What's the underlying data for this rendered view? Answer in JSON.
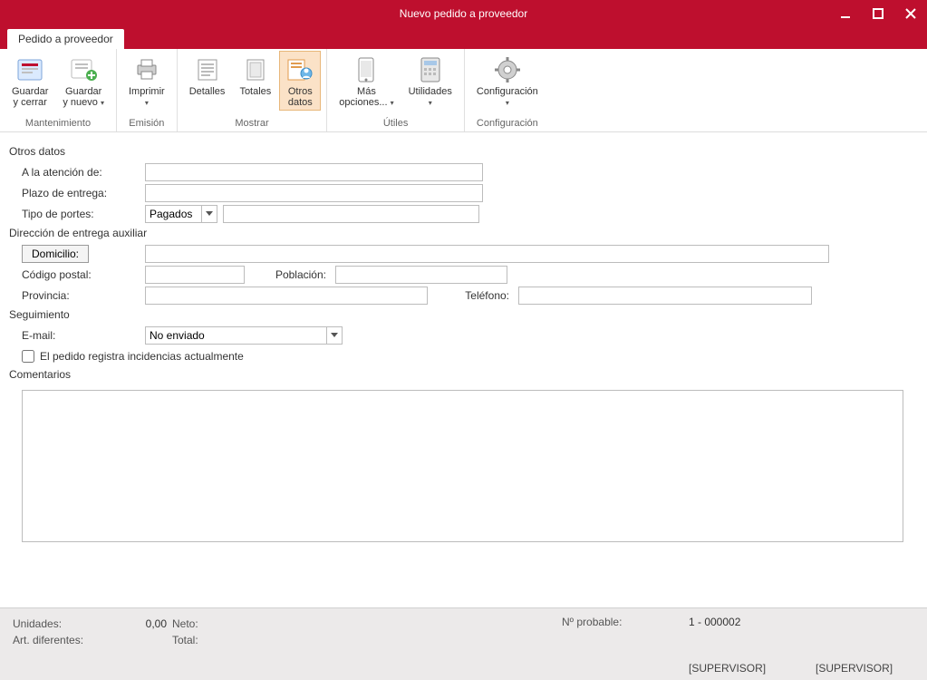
{
  "window": {
    "title": "Nuevo pedido a proveedor"
  },
  "tab": {
    "label": "Pedido a proveedor"
  },
  "ribbon": {
    "groups": [
      {
        "label": "Mantenimiento",
        "buttons": [
          {
            "line1": "Guardar",
            "line2": "y cerrar"
          },
          {
            "line1": "Guardar",
            "line2": "y nuevo",
            "dropdown": true
          }
        ]
      },
      {
        "label": "Emisión",
        "buttons": [
          {
            "line1": "Imprimir",
            "line2": "",
            "dropdown": true
          }
        ]
      },
      {
        "label": "Mostrar",
        "buttons": [
          {
            "line1": "Detalles",
            "line2": ""
          },
          {
            "line1": "Totales",
            "line2": ""
          },
          {
            "line1": "Otros",
            "line2": "datos",
            "active": true
          }
        ]
      },
      {
        "label": "Útiles",
        "buttons": [
          {
            "line1": "Más",
            "line2": "opciones...",
            "dropdown": true
          },
          {
            "line1": "Utilidades",
            "line2": "",
            "dropdown": true
          }
        ]
      },
      {
        "label": "Configuración",
        "buttons": [
          {
            "line1": "Configuración",
            "line2": "",
            "dropdown": true
          }
        ]
      }
    ]
  },
  "sections": {
    "otros_datos": {
      "title": "Otros datos",
      "atencion_label": "A la atención de:",
      "plazo_label": "Plazo de entrega:",
      "portes_label": "Tipo de portes:",
      "portes_value": "Pagados"
    },
    "direccion": {
      "title": "Dirección de entrega auxiliar",
      "domicilio_btn": "Domicilio:",
      "cp_label": "Código postal:",
      "poblacion_label": "Población:",
      "provincia_label": "Provincia:",
      "telefono_label": "Teléfono:"
    },
    "seguimiento": {
      "title": "Seguimiento",
      "email_label": "E-mail:",
      "email_value": "No enviado",
      "incidencias_label": "El pedido registra incidencias actualmente"
    },
    "comentarios": {
      "title": "Comentarios"
    }
  },
  "footer": {
    "unidades_label": "Unidades:",
    "unidades_value": "0,00",
    "neto_label": "Neto:",
    "artdif_label": "Art. diferentes:",
    "total_label": "Total:",
    "probable_label": "Nº probable:",
    "probable_value": "1 - 000002",
    "supervisor_1": "[SUPERVISOR]",
    "supervisor_2": "[SUPERVISOR]"
  }
}
